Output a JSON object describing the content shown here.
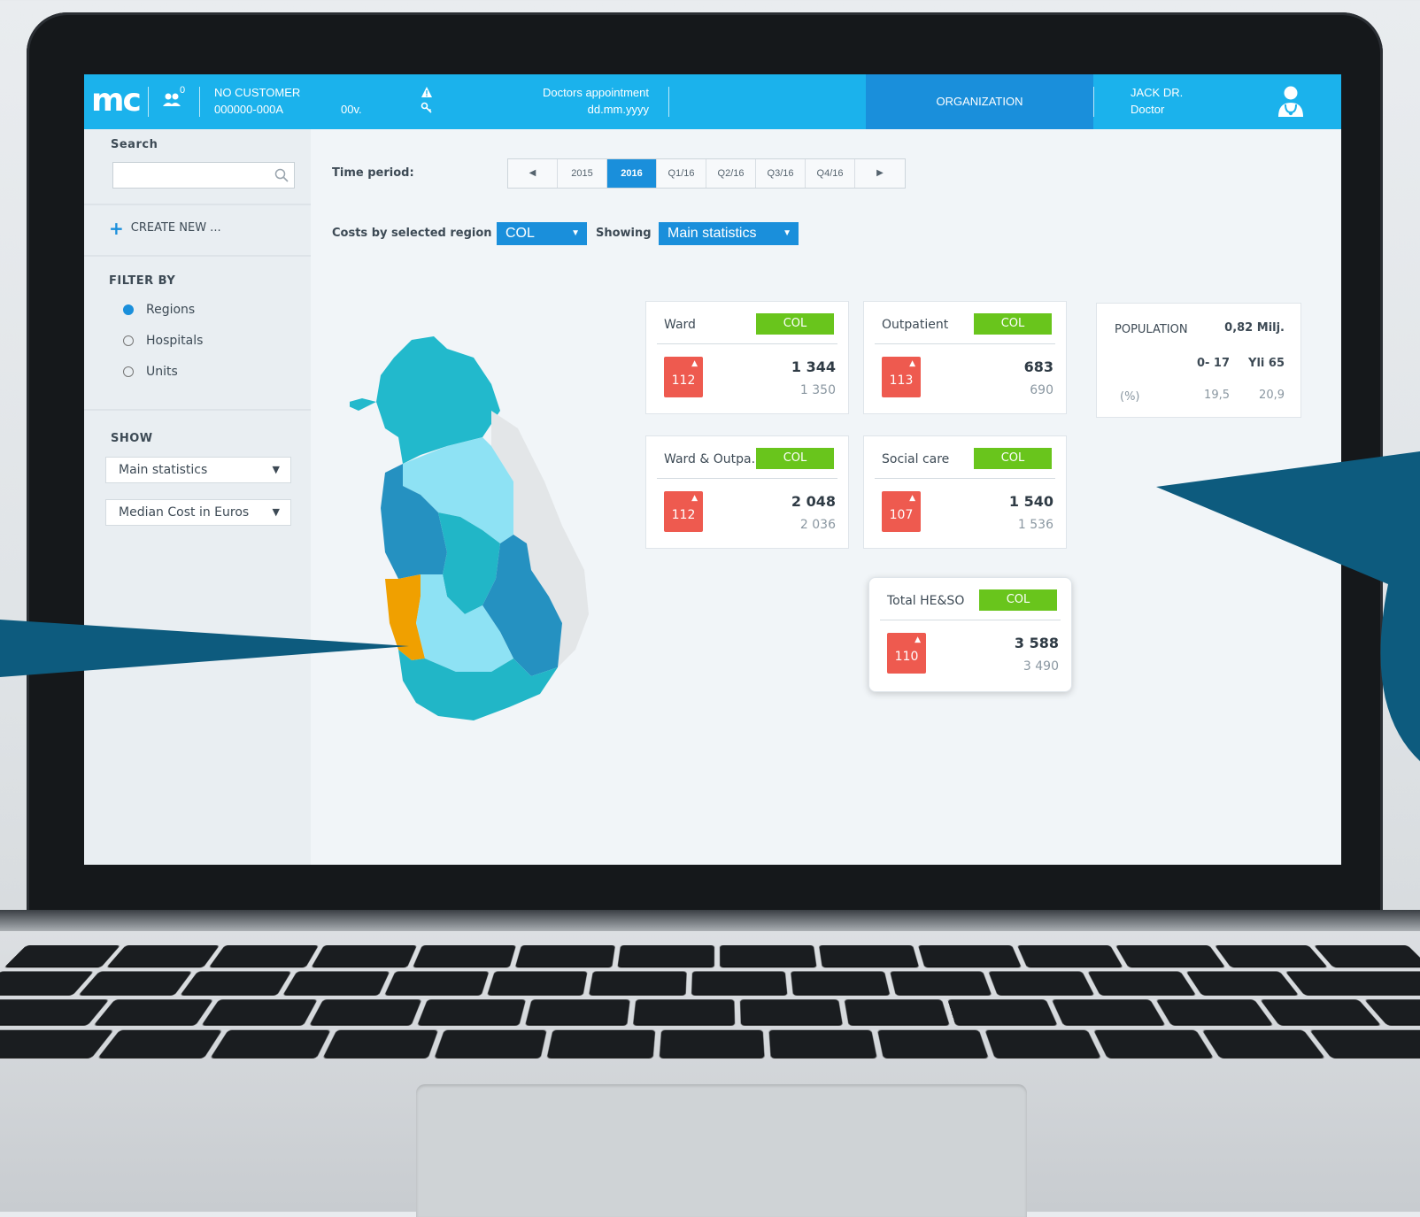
{
  "topbar": {
    "logo": "mc",
    "users_count": "0",
    "customer_name": "NO CUSTOMER",
    "customer_id": "000000-000A",
    "ov": "00v.",
    "appointment_title": "Doctors appointment",
    "appointment_date": "dd.mm.yyyy",
    "organization_tab": "ORGANIZATION",
    "user_name": "JACK DR.",
    "user_role": "Doctor"
  },
  "sidebar": {
    "search_label": "Search",
    "search_placeholder": "",
    "create_new": "CREATE NEW ...",
    "filter_by_label": "FILTER BY",
    "filters": [
      {
        "label": "Regions",
        "selected": true
      },
      {
        "label": "Hospitals",
        "selected": false
      },
      {
        "label": "Units",
        "selected": false
      }
    ],
    "show_label": "SHOW",
    "show_select_1": "Main statistics",
    "show_select_2": "Median Cost in Euros"
  },
  "main": {
    "time_period_label": "Time period:",
    "periods": [
      "2015",
      "2016",
      "Q1/16",
      "Q2/16",
      "Q3/16",
      "Q4/16"
    ],
    "active_period": "2016",
    "costs_label": "Costs by selected region",
    "region_select": "COL",
    "showing_label": "Showing",
    "showing_select": "Main statistics"
  },
  "cards": [
    {
      "title": "Ward",
      "badge": "COL",
      "rank": "112",
      "value": "1 344",
      "compare": "1 350"
    },
    {
      "title": "Outpatient",
      "badge": "COL",
      "rank": "113",
      "value": "683",
      "compare": "690"
    },
    {
      "title": "Ward & Outpa.",
      "badge": "COL",
      "rank": "112",
      "value": "2 048",
      "compare": "2 036"
    },
    {
      "title": "Social care",
      "badge": "COL",
      "rank": "107",
      "value": "1 540",
      "compare": "1 536"
    },
    {
      "title": "Total HE&SO",
      "badge": "COL",
      "rank": "110",
      "value": "3 588",
      "compare": "3 490"
    }
  ],
  "population": {
    "title": "POPULATION",
    "total": "0,82 Milj.",
    "col_1": "0- 17",
    "col_2": "Yli 65",
    "row_label": "(%)",
    "val_1": "19,5",
    "val_2": "20,9"
  },
  "colors": {
    "topbar": "#1bb2ec",
    "accent": "#1a8fdb",
    "badge": "#69c51c",
    "rank": "#ee5a4f",
    "highlight_region": "#f0a000",
    "overlay_arrow": "#0d5b7e"
  }
}
